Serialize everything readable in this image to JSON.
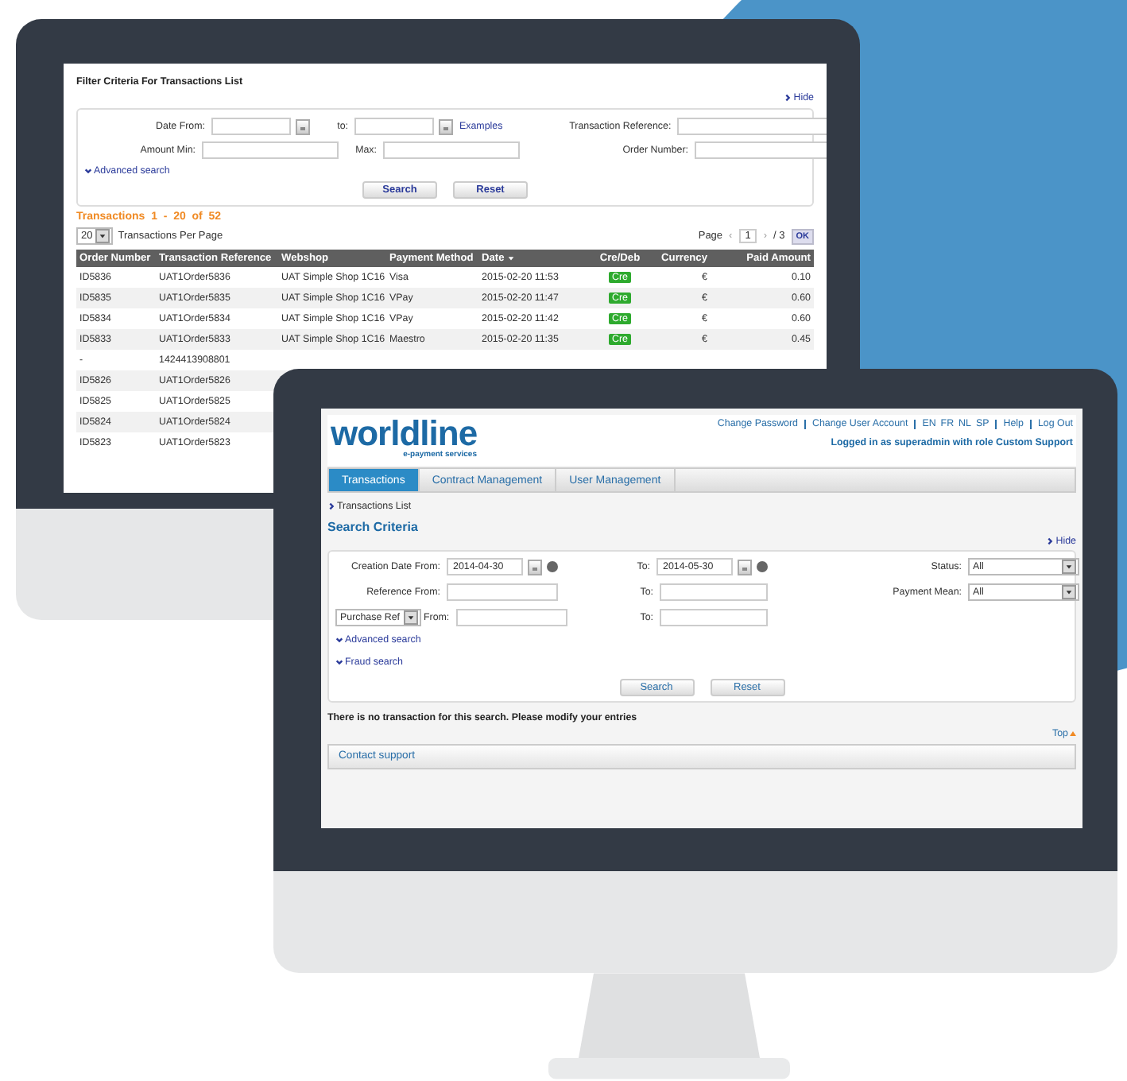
{
  "back_window": {
    "title": "Filter Criteria For Transactions List",
    "hide_link": "Hide",
    "filter": {
      "rows": [
        [
          {
            "label": "Date From:",
            "control": {
              "kind": "date"
            }
          },
          {
            "label": "to:",
            "control": {
              "kind": "date"
            },
            "link": "Examples"
          },
          {
            "label": "Transaction Reference:",
            "control": {
              "kind": "text"
            }
          }
        ],
        [
          {
            "label": "Amount Min:",
            "control": {
              "kind": "text"
            }
          },
          {
            "label": "Max:",
            "control": {
              "kind": "text"
            }
          },
          {
            "label": "Order Number:",
            "control": {
              "kind": "text"
            }
          }
        ]
      ],
      "advanced_link": "Advanced search",
      "buttons": [
        "Search",
        "Reset"
      ]
    },
    "results_title": "Transactions  1  -  20  of  52",
    "per_page": {
      "value": "20",
      "label": "Transactions Per Page"
    },
    "pager": {
      "label": "Page",
      "prev": "‹",
      "page": "1",
      "next": "›",
      "total": "/ 3",
      "ok": "OK"
    },
    "table": {
      "columns": [
        {
          "label": "Order Number",
          "kind": "text",
          "sorted": false
        },
        {
          "label": "Transaction Reference",
          "kind": "text",
          "sorted": false
        },
        {
          "label": "Webshop",
          "kind": "text",
          "sorted": false
        },
        {
          "label": "Payment Method",
          "kind": "text",
          "sorted": false
        },
        {
          "label": "Date",
          "kind": "text",
          "sorted": true
        },
        {
          "label": "Cre/Deb",
          "kind": "badge",
          "sorted": false
        },
        {
          "label": "Currency",
          "kind": "num",
          "sorted": false
        },
        {
          "label": "Paid Amount",
          "kind": "num",
          "sorted": false
        }
      ],
      "rows": [
        [
          "ID5836",
          "UAT1Order5836",
          "UAT Simple Shop 1C16",
          "Visa",
          "2015-02-20 11:53",
          "Cre",
          "€",
          "0.10"
        ],
        [
          "ID5835",
          "UAT1Order5835",
          "UAT Simple Shop 1C16",
          "VPay",
          "2015-02-20 11:47",
          "Cre",
          "€",
          "0.60"
        ],
        [
          "ID5834",
          "UAT1Order5834",
          "UAT Simple Shop 1C16",
          "VPay",
          "2015-02-20 11:42",
          "Cre",
          "€",
          "0.60"
        ],
        [
          "ID5833",
          "UAT1Order5833",
          "UAT Simple Shop 1C16",
          "Maestro",
          "2015-02-20 11:35",
          "Cre",
          "€",
          "0.45"
        ],
        [
          "-",
          "1424413908801"
        ],
        [
          "ID5826",
          "UAT1Order5826"
        ],
        [
          "ID5825",
          "UAT1Order5825"
        ],
        [
          "ID5824",
          "UAT1Order5824"
        ],
        [
          "ID5823",
          "UAT1Order5823"
        ]
      ]
    }
  },
  "front_window": {
    "logo": {
      "name": "worldline",
      "tagline": "e-payment services"
    },
    "top_links": [
      "Change Password",
      "Change User Account",
      "EN",
      "FR",
      "NL",
      "SP",
      "Help",
      "Log Out"
    ],
    "logged_in": "Logged in as superadmin with role Custom Support",
    "tabs": [
      {
        "label": "Transactions",
        "selected": true
      },
      {
        "label": "Contract Management",
        "selected": false
      },
      {
        "label": "User Management",
        "selected": false
      }
    ],
    "breadcrumb": "Transactions List",
    "heading": "Search Criteria",
    "hide_link": "Hide",
    "filter": {
      "rows": [
        [
          {
            "label": "Creation Date From:",
            "control": {
              "kind": "date",
              "value": "2014-04-30",
              "help": true
            }
          },
          {
            "label": "To:",
            "control": {
              "kind": "date",
              "value": "2014-05-30",
              "help": true
            }
          },
          {
            "label": "Status:",
            "control": {
              "kind": "select",
              "value": "All"
            }
          }
        ],
        [
          {
            "label": "Reference From:",
            "control": {
              "kind": "text"
            }
          },
          {
            "label": "To:",
            "control": {
              "kind": "text"
            }
          },
          {
            "label": "Payment Mean:",
            "control": {
              "kind": "select",
              "value": "All"
            }
          }
        ],
        [
          {
            "prefix_select": "Purchase Ref",
            "label": "From:",
            "control": {
              "kind": "text"
            }
          },
          {
            "label": "To:",
            "control": {
              "kind": "text"
            }
          }
        ]
      ],
      "links": [
        "Advanced search",
        "Fraud search"
      ],
      "buttons": [
        "Search",
        "Reset"
      ]
    },
    "message": "There is no transaction for this search. Please modify your entries",
    "top_link": "Top",
    "support": "Contact support"
  }
}
